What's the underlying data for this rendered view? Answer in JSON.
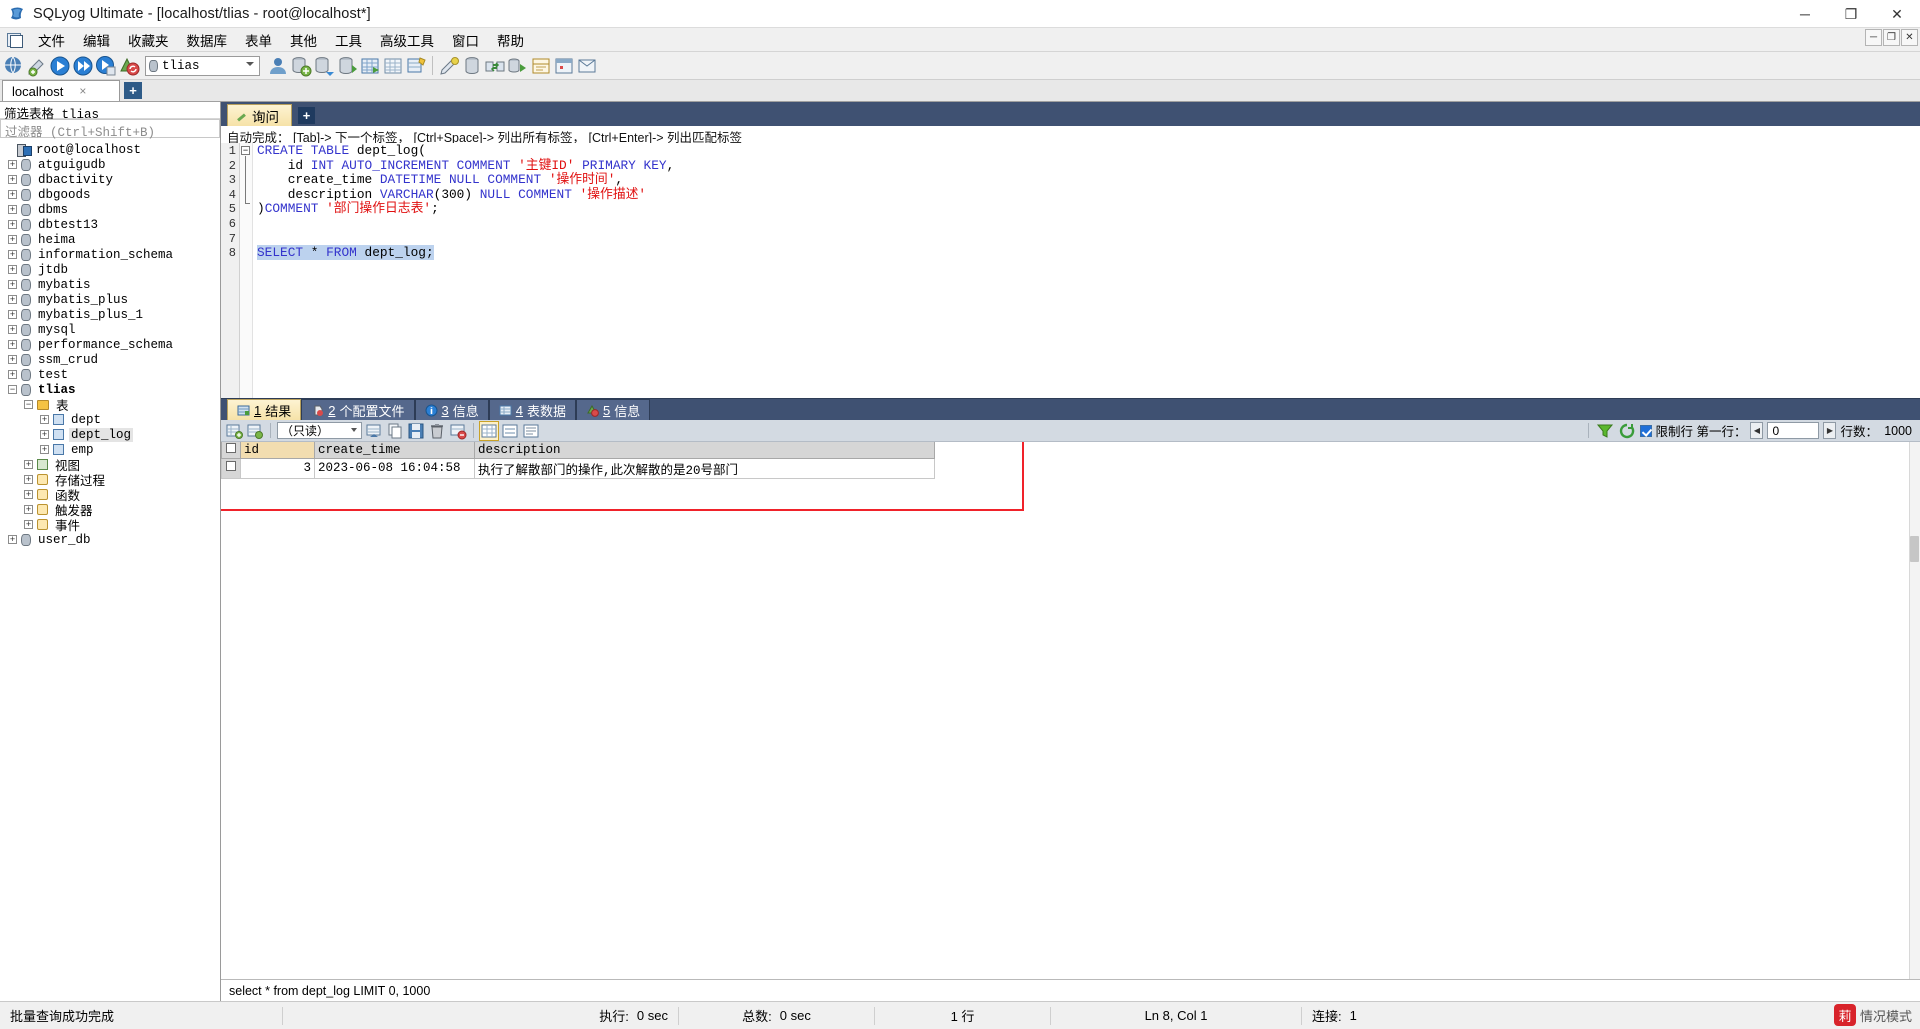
{
  "window": {
    "title": "SQLyog Ultimate - [localhost/tlias - root@localhost*]",
    "app_icon": "sqlyog-icon",
    "minimize": "─",
    "maximize": "❐",
    "close": "✕",
    "mdi_minimize": "─",
    "mdi_restore": "❐",
    "mdi_close": "✕"
  },
  "menu": {
    "items": [
      {
        "label": "文件",
        "name": "menu-file"
      },
      {
        "label": "编辑",
        "name": "menu-edit"
      },
      {
        "label": "收藏夹",
        "name": "menu-favorites"
      },
      {
        "label": "数据库",
        "name": "menu-database"
      },
      {
        "label": "表单",
        "name": "menu-form"
      },
      {
        "label": "其他",
        "name": "menu-other"
      },
      {
        "label": "工具",
        "name": "menu-tools"
      },
      {
        "label": "高级工具",
        "name": "menu-advanced-tools"
      },
      {
        "label": "窗口",
        "name": "menu-window"
      },
      {
        "label": "帮助",
        "name": "menu-help"
      }
    ]
  },
  "toolbar": {
    "database_selected": "tlias",
    "icons": [
      "new-connection-icon",
      "new-query-tab-icon",
      "execute-query-icon",
      "execute-all-icon",
      "execute-current-icon",
      "refresh-objects-icon"
    ],
    "icons_right": [
      "user-manager-icon",
      "db-backup-icon",
      "db-restore-icon",
      "import-external-icon",
      "table-data-icon",
      "grid-view-icon",
      "schema-designer-icon"
    ],
    "icons_far": [
      "sql-formatter-icon",
      "db-sync-icon",
      "data-sync-icon",
      "schema-sync-icon",
      "query-builder-icon",
      "scheduler-icon",
      "notification-icon"
    ]
  },
  "connection_tabs": {
    "tabs": [
      {
        "label": "localhost",
        "close": "×"
      }
    ],
    "add_label": "+"
  },
  "sidebar": {
    "filter_title": "筛选表格 tlias",
    "filter_placeholder": "过滤器 (Ctrl+Shift+B)",
    "root": {
      "label": "root@localhost",
      "icon": "server-icon"
    },
    "databases": [
      {
        "label": "atguigudb",
        "expanded": false
      },
      {
        "label": "dbactivity",
        "expanded": false
      },
      {
        "label": "dbgoods",
        "expanded": false
      },
      {
        "label": "dbms",
        "expanded": false
      },
      {
        "label": "dbtest13",
        "expanded": false
      },
      {
        "label": "heima",
        "expanded": false
      },
      {
        "label": "information_schema",
        "expanded": false
      },
      {
        "label": "jtdb",
        "expanded": false
      },
      {
        "label": "mybatis",
        "expanded": false
      },
      {
        "label": "mybatis_plus",
        "expanded": false
      },
      {
        "label": "mybatis_plus_1",
        "expanded": false
      },
      {
        "label": "mysql",
        "expanded": false
      },
      {
        "label": "performance_schema",
        "expanded": false
      },
      {
        "label": "ssm_crud",
        "expanded": false
      },
      {
        "label": "test",
        "expanded": false
      },
      {
        "label": "tlias",
        "expanded": true
      }
    ],
    "tlias_children": {
      "tables_folder": "表",
      "tables": [
        "dept",
        "dept_log",
        "emp"
      ],
      "views": "视图",
      "procedures": "存储过程",
      "functions": "函数",
      "triggers": "触发器",
      "events": "事件"
    },
    "after_tlias": [
      {
        "label": "user_db",
        "expanded": false
      }
    ]
  },
  "query_tabs": {
    "tabs": [
      {
        "label": "询问",
        "icon": "query-pen-icon"
      }
    ],
    "add_label": "+"
  },
  "editor": {
    "hint": "自动完成： [Tab]-> 下一个标签， [Ctrl+Space]-> 列出所有标签， [Ctrl+Enter]-> 列出匹配标签",
    "line_numbers": [
      "1",
      "2",
      "3",
      "4",
      "5",
      "6",
      "7",
      "8"
    ],
    "lines": [
      [
        {
          "t": "CREATE TABLE",
          "c": "kw"
        },
        {
          "t": " dept_log(",
          "c": "plain"
        }
      ],
      [
        {
          "t": "    id ",
          "c": "plain"
        },
        {
          "t": "INT AUTO_INCREMENT COMMENT ",
          "c": "kw"
        },
        {
          "t": "'主键ID'",
          "c": "str"
        },
        {
          "t": " ",
          "c": "plain"
        },
        {
          "t": "PRIMARY KEY",
          "c": "kw"
        },
        {
          "t": ",",
          "c": "plain"
        }
      ],
      [
        {
          "t": "    create_time ",
          "c": "plain"
        },
        {
          "t": "DATETIME NULL COMMENT ",
          "c": "kw"
        },
        {
          "t": "'操作时间'",
          "c": "str"
        },
        {
          "t": ",",
          "c": "plain"
        }
      ],
      [
        {
          "t": "    description ",
          "c": "plain"
        },
        {
          "t": "VARCHAR",
          "c": "kw"
        },
        {
          "t": "(300) ",
          "c": "plain"
        },
        {
          "t": "NULL COMMENT ",
          "c": "kw"
        },
        {
          "t": "'操作描述'",
          "c": "str"
        }
      ],
      [
        {
          "t": ")",
          "c": "plain"
        },
        {
          "t": "COMMENT ",
          "c": "kw"
        },
        {
          "t": "'部门操作日志表'",
          "c": "str"
        },
        {
          "t": ";",
          "c": "plain"
        }
      ],
      [],
      [],
      [
        {
          "t": "SELECT",
          "c": "kw selhl"
        },
        {
          "t": " * ",
          "c": "plain selhl"
        },
        {
          "t": "FROM",
          "c": "kw selhl"
        },
        {
          "t": " dept_log;",
          "c": "plain selhl"
        }
      ]
    ]
  },
  "result_tabs": [
    {
      "num": "1",
      "label": "结果",
      "icon": "result-grid-icon",
      "active": true
    },
    {
      "num": "2",
      "label": "个配置文件",
      "icon": "profile-icon",
      "active": false
    },
    {
      "num": "3",
      "label": "信息",
      "icon": "info-icon",
      "active": false
    },
    {
      "num": "4",
      "label": "表数据",
      "icon": "table-data-icon",
      "active": false
    },
    {
      "num": "5",
      "label": "信息",
      "icon": "messages-icon",
      "active": false
    }
  ],
  "grid_toolbar": {
    "mode": "（只读）",
    "icons_left": [
      "add-row-icon",
      "insert-row-icon"
    ],
    "icons_mid": [
      "refresh-data-icon",
      "duplicate-row-icon",
      "save-changes-icon",
      "delete-row-icon",
      "apply-changes-icon"
    ],
    "icons_view": [
      "grid-view-icon",
      "form-view-icon",
      "text-view-icon"
    ],
    "filter_icon": "filter-funnel-icon",
    "refresh_icon": "refresh-circle-icon",
    "limit_label": "限制行 第一行：",
    "limit_offset": "0",
    "rows_label": "行数：",
    "rows_value": "1000",
    "prev_arrow": "◀",
    "next_arrow": "▶"
  },
  "result_grid": {
    "columns": [
      "id",
      "create_time",
      "description"
    ],
    "rows": [
      {
        "id": "3",
        "create_time": "2023-06-08 16:04:58",
        "description": "执行了解散部门的操作,此次解散的是20号部门"
      }
    ]
  },
  "query_echo": "select * from dept_log LIMIT 0, 1000",
  "status": {
    "message": "批量查询成功完成",
    "exec_label": "执行:",
    "exec_value": "0 sec",
    "total_label": "总数:",
    "total_value": "0 sec",
    "rows": "1 行",
    "caret": "Ln 8, Col 1",
    "connection_label": "连接:",
    "connection_value": "1",
    "watermark": "情况模式"
  },
  "colors": {
    "accent_blue": "#3f5172",
    "tab_active": "#f6e2a8",
    "keyword": "#3333cc",
    "string": "#e01010",
    "highlight_rect": "#f0222a"
  }
}
